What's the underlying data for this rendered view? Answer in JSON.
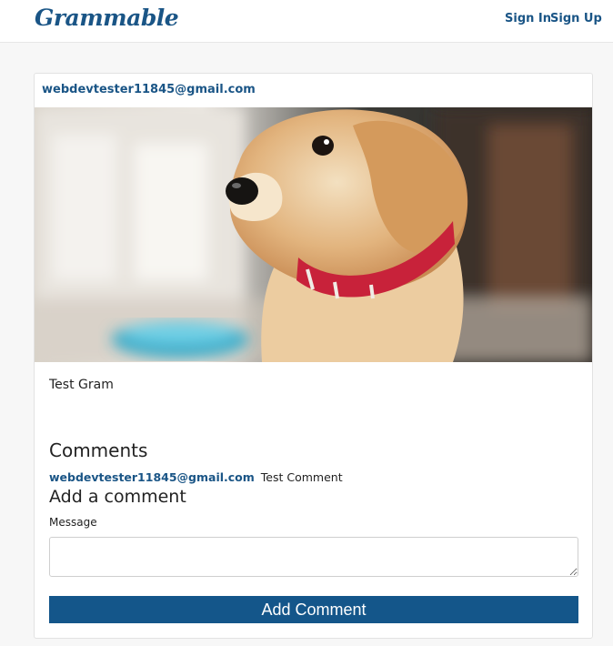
{
  "navbar": {
    "brand": "Grammable",
    "sign_in": "Sign In",
    "sign_up": "Sign Up"
  },
  "gram": {
    "user_email": "webdevtester11845@gmail.com",
    "caption": "Test Gram"
  },
  "comments": {
    "heading": "Comments",
    "items": [
      {
        "author": "webdevtester11845@gmail.com",
        "text": "Test Comment"
      }
    ]
  },
  "comment_form": {
    "heading": "Add a comment",
    "message_label": "Message",
    "message_value": "",
    "submit_label": "Add Comment"
  },
  "colors": {
    "brand": "#1a5586",
    "button": "#14568a",
    "collar": "#c8223a",
    "bowl": "#2aa8c8"
  }
}
